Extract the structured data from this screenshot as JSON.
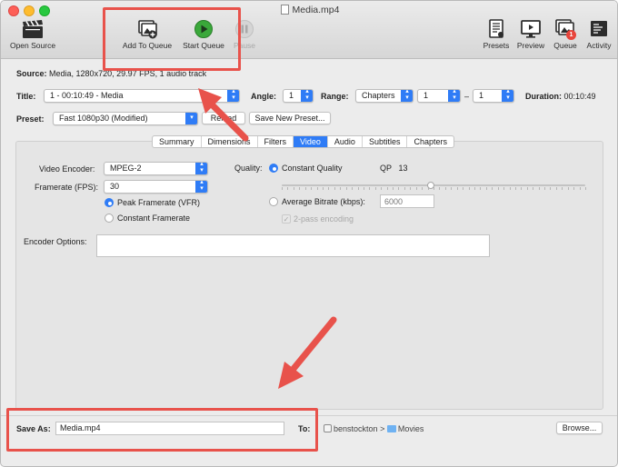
{
  "window": {
    "title": "Media.mp4"
  },
  "toolbar": {
    "open_source": "Open Source",
    "add_to_queue": "Add To Queue",
    "start_queue": "Start Queue",
    "pause": "Pause",
    "presets": "Presets",
    "preview": "Preview",
    "queue": "Queue",
    "activity": "Activity",
    "queue_badge": "1"
  },
  "source": {
    "label": "Source:",
    "value": "Media, 1280x720, 29.97 FPS, 1 audio track"
  },
  "title_row": {
    "title_label": "Title:",
    "title_value": "1 - 00:10:49 - Media",
    "angle_label": "Angle:",
    "angle_value": "1",
    "range_label": "Range:",
    "range_type": "Chapters",
    "range_start": "1",
    "range_sep": "–",
    "range_end": "1",
    "duration_label": "Duration:",
    "duration_value": "00:10:49"
  },
  "preset_row": {
    "label": "Preset:",
    "value": "Fast 1080p30 (Modified)",
    "reload": "Reload",
    "save_new": "Save New Preset..."
  },
  "tabs": [
    "Summary",
    "Dimensions",
    "Filters",
    "Video",
    "Audio",
    "Subtitles",
    "Chapters"
  ],
  "active_tab": "Video",
  "video": {
    "encoder_label": "Video Encoder:",
    "encoder_value": "MPEG-2",
    "framerate_label": "Framerate (FPS):",
    "framerate_value": "30",
    "peak_framerate": "Peak Framerate (VFR)",
    "constant_framerate": "Constant Framerate",
    "quality_label": "Quality:",
    "constant_quality": "Constant Quality",
    "qp_label": "QP",
    "qp_value": "13",
    "qp_slider_fraction": 0.49,
    "average_bitrate": "Average Bitrate (kbps):",
    "bitrate_placeholder": "6000",
    "two_pass": "2-pass encoding",
    "encoder_options_label": "Encoder Options:"
  },
  "footer": {
    "save_as_label": "Save As:",
    "save_as_value": "Media.mp4",
    "to_label": "To:",
    "path_user": "benstockton",
    "path_sep": ">",
    "path_folder": "Movies",
    "browse": "Browse..."
  },
  "colors": {
    "accent": "#2f7cf6",
    "annotation": "#e8524b"
  }
}
